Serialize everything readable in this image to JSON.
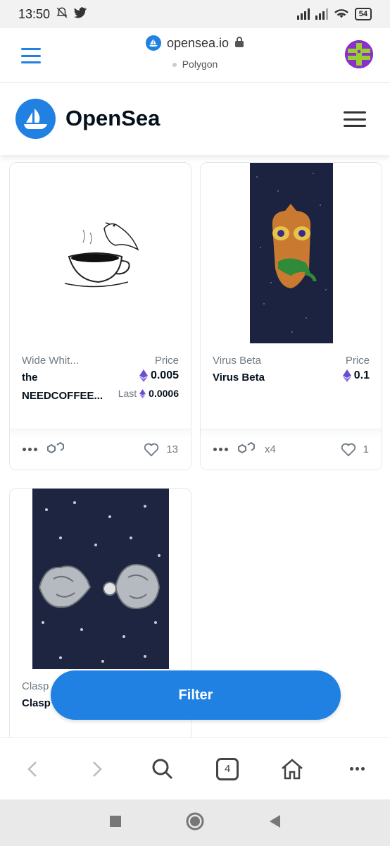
{
  "status_bar": {
    "time": "13:50",
    "battery": "54"
  },
  "browser": {
    "url": "opensea.io",
    "network": "Polygon"
  },
  "site": {
    "title": "OpenSea"
  },
  "cards": [
    {
      "collection": "Wide Whit...",
      "price_label": "Price",
      "name_line1": "the",
      "name_line2": "NEEDCOFFEE...",
      "price": "0.005",
      "last_label": "Last",
      "last_price": "0.0006",
      "likes": "13"
    },
    {
      "collection": "Virus Beta",
      "price_label": "Price",
      "name": "Virus Beta",
      "price": "0.1",
      "edition": "x4",
      "likes": "1"
    },
    {
      "collection": "Clasp",
      "name": "Clasp"
    }
  ],
  "filter": {
    "label": "Filter"
  },
  "bottom_bar": {
    "tabs_count": "4"
  },
  "icons": {
    "eth_color": "#6b4fd1",
    "brand_blue": "#2081e2"
  }
}
